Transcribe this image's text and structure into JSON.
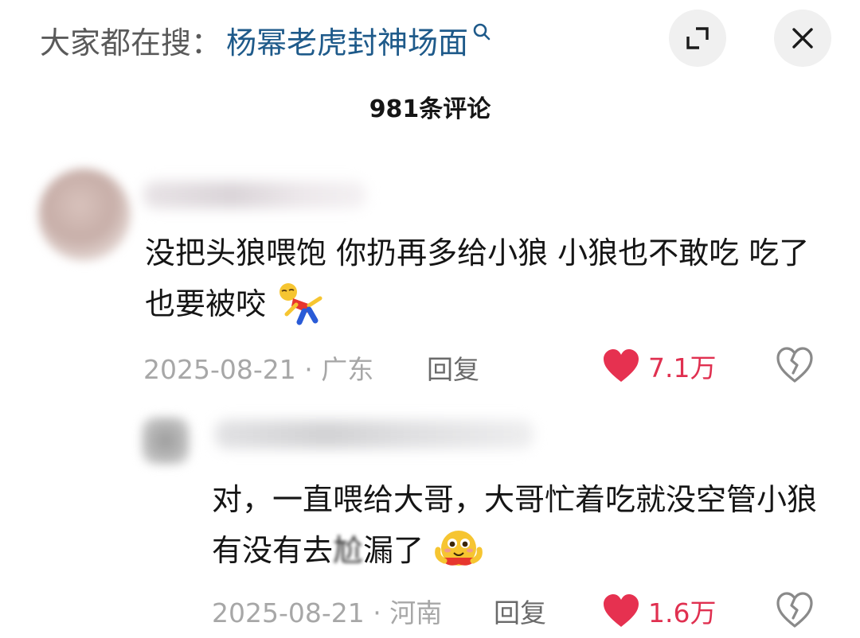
{
  "search": {
    "prefix": "大家都在搜：",
    "term": "杨幂老虎封神场面"
  },
  "comments_header": {
    "count_label": "981条评论"
  },
  "comments": [
    {
      "text": "没把头狼喂饱 你扔再多给小狼 小狼也不敢吃 吃了也要被咬",
      "emoji": "falling-person-emoji",
      "date": "2025-08-21",
      "location": "广东",
      "reply_label": "回复",
      "likes": "7.1万"
    },
    {
      "text": "对，一直喂给大哥，大哥忙着吃就没空管小狼有没有去",
      "censored_chars": "尬",
      "text_tail": "漏了",
      "emoji": "hugging-face-emoji",
      "date": "2025-08-21",
      "location": "河南",
      "reply_label": "回复",
      "likes": "1.6万"
    }
  ],
  "colors": {
    "accent_like": "#e03050",
    "search_term": "#1e5a8a",
    "meta_gray": "#a7a7a7"
  }
}
